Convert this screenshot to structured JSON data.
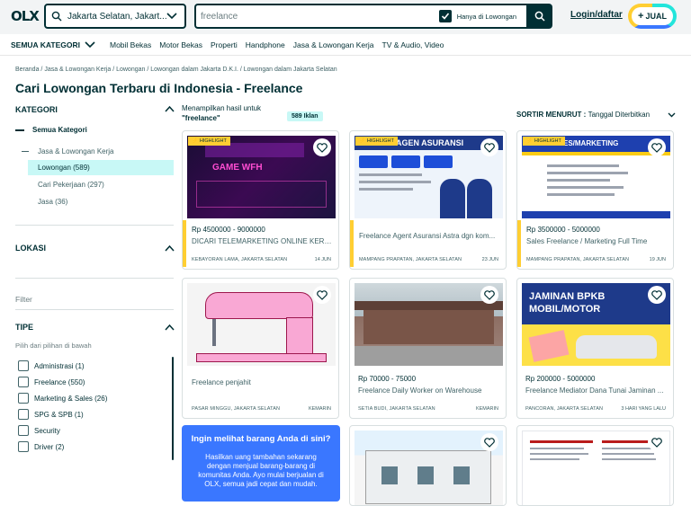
{
  "header": {
    "logo": "OLX",
    "location": "Jakarta Selatan, Jakart...",
    "search_placeholder": "freelance",
    "only_jobs_label": "Hanya di Lowongan",
    "login_label": "Login/daftar",
    "sell_label": "JUAL"
  },
  "nav": {
    "all_categories": "SEMUA KATEGORI",
    "items": [
      "Mobil Bekas",
      "Motor Bekas",
      "Properti",
      "Handphone",
      "Jasa & Lowongan Kerja",
      "TV & Audio, Video"
    ]
  },
  "breadcrumb": [
    "Beranda",
    "Jasa & Lowongan Kerja",
    "Lowongan",
    "Lowongan dalam Jakarta D.K.I.",
    "Lowongan dalam Jakarta Selatan"
  ],
  "page_title": "Cari Lowongan Terbaru di Indonesia - Freelance",
  "sidebar": {
    "category_heading": "KATEGORI",
    "all_categories": "Semua Kategori",
    "parent_category": "Jasa & Lowongan Kerja",
    "selected_category": "Lowongan (589)",
    "sub_categories": [
      "Cari Pekerjaan (297)",
      "Jasa (36)"
    ],
    "location_heading": "LOKASI",
    "filter_label": "Filter",
    "type_heading": "TIPE",
    "type_hint": "Pilih dari pilihan di bawah",
    "type_options": [
      "Administrasi (1)",
      "Freelance (550)",
      "Marketing & Sales (26)",
      "SPG & SPB (1)",
      "Security",
      "Driver (2)"
    ]
  },
  "results": {
    "showing_label": "Menampilkan hasil untuk",
    "query": "\"freelance\"",
    "count_badge": "589 Iklan",
    "sort_label": "SORTIR MENURUT :",
    "sort_value": "Tanggal Diterbitkan"
  },
  "highlight_label": "HIGHLIGHT",
  "cards": [
    {
      "price": "Rp 4500000 - 9000000",
      "title": "DICARI TELEMARKETING ONLINE KERJA...",
      "location": "KEBAYORAN LAMA, JAKARTA SELATAN",
      "date": "14 JUN",
      "highlight": true,
      "image_text": "GAME WFH"
    },
    {
      "price": "",
      "title": "Freelance Agent Asuransi Astra dgn kom...",
      "location": "MAMPANG PRAPATAN, JAKARTA SELATAN",
      "date": "23 JUN",
      "highlight": true,
      "image_text": "AGEN ASURANSI"
    },
    {
      "price": "Rp 3500000 - 5000000",
      "title": "Sales Freelance / Marketing Full Time",
      "location": "MAMPANG PRAPATAN, JAKARTA SELATAN",
      "date": "19 JUN",
      "highlight": true,
      "image_text": "SALES/MARKETING"
    },
    {
      "price": "",
      "title": "Freelance penjahit",
      "location": "PASAR MINGGU, JAKARTA SELATAN",
      "date": "KEMARIN",
      "highlight": false,
      "image_text": ""
    },
    {
      "price": "Rp 70000 - 75000",
      "title": "Freelance Daily Worker on Warehouse",
      "location": "SETIA BUDI, JAKARTA SELATAN",
      "date": "KEMARIN",
      "highlight": false,
      "image_text": ""
    },
    {
      "price": "Rp 200000 - 5000000",
      "title": "Freelance Mediator Dana Tunai Jaminan ...",
      "location": "PANCORAN, JAKARTA SELATAN",
      "date": "3 HARI YANG LALU",
      "highlight": false,
      "image_text": "JAMINAN BPKB MOBIL/MOTOR"
    }
  ],
  "promo": {
    "title": "Ingin melihat barang Anda di sini?",
    "body": "Hasilkan uang tambahan sekarang dengan menjual barang-barang di komunitas Anda. Ayo mulai berjualan di OLX, semua jadi cepat dan mudah."
  },
  "colors": {
    "primary": "#002f34",
    "accent_teal": "#23e5db",
    "accent_blue": "#3a77ff",
    "accent_yellow": "#ffce32",
    "selected_bg": "#c8f8f6"
  }
}
